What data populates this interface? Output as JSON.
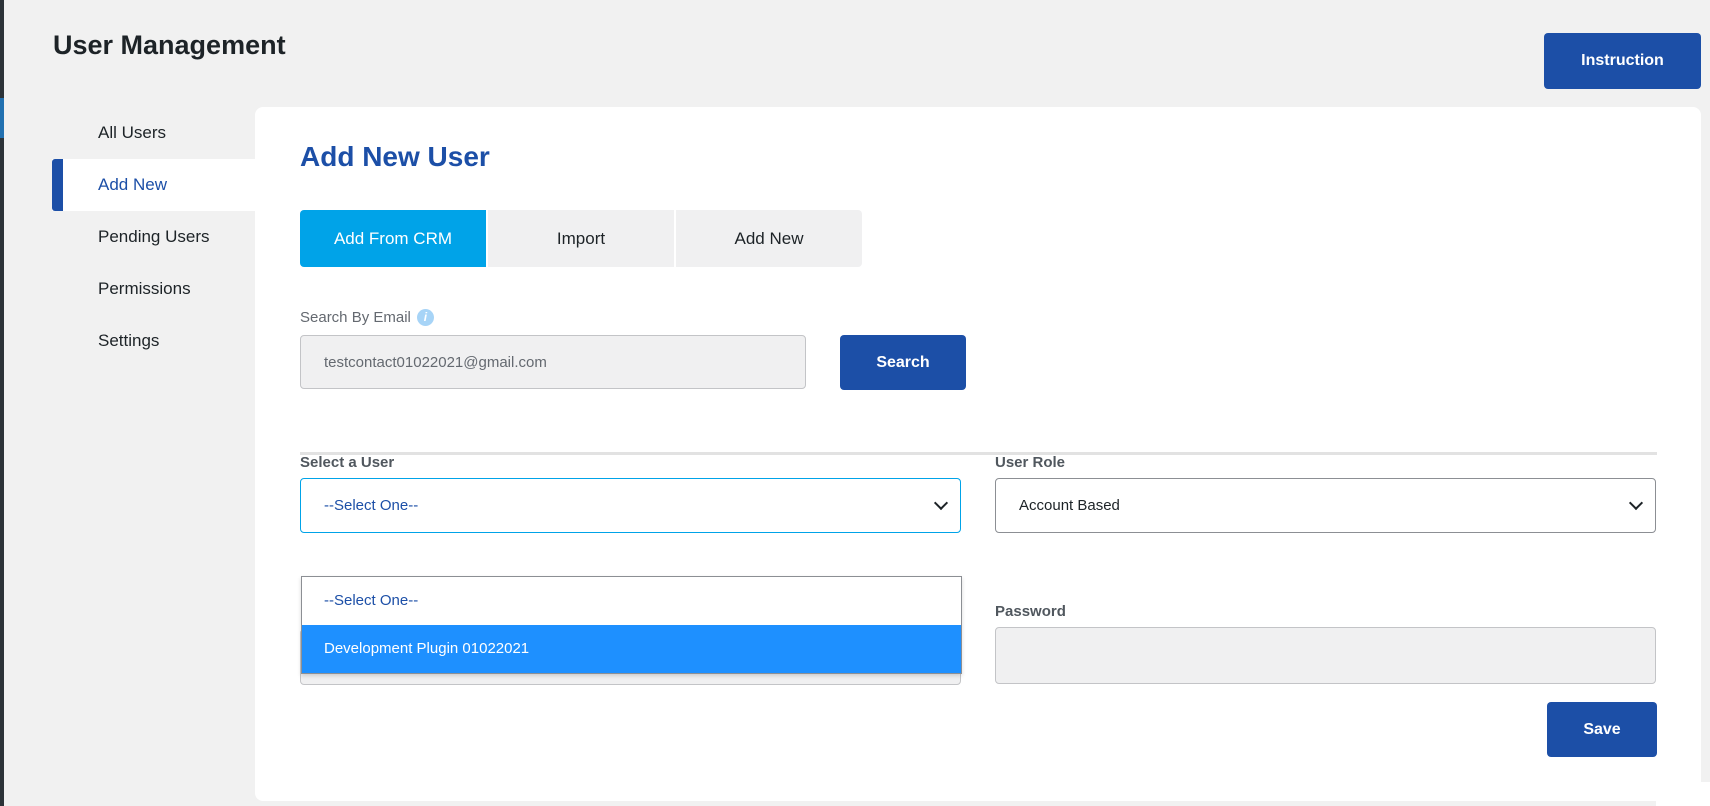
{
  "header": {
    "title": "User Management",
    "instruction_label": "Instruction"
  },
  "sidebar": {
    "items": [
      {
        "label": "All Users"
      },
      {
        "label": "Add New",
        "active": true
      },
      {
        "label": "Pending Users"
      },
      {
        "label": "Permissions"
      },
      {
        "label": "Settings"
      }
    ]
  },
  "main": {
    "title": "Add New User",
    "tabs": [
      {
        "label": "Add From CRM",
        "active": true
      },
      {
        "label": "Import"
      },
      {
        "label": "Add New"
      }
    ],
    "search": {
      "label": "Search By Email",
      "info_icon": "info-icon",
      "value": "testcontact01022021@gmail.com",
      "button_label": "Search"
    },
    "select_user": {
      "label": "Select a User",
      "value": "--Select One--",
      "options": [
        "--Select One--",
        "Development Plugin 01022021"
      ],
      "highlighted_option": "Development Plugin 01022021"
    },
    "user_role": {
      "label": "User Role",
      "value": "Account Based"
    },
    "password": {
      "label": "Password",
      "value": ""
    },
    "save_label": "Save"
  },
  "colors": {
    "primary": "#1c4fa7",
    "tab_active": "#00a3e8",
    "option_highlight": "#1e90ff",
    "background": "#f1f1f1"
  }
}
